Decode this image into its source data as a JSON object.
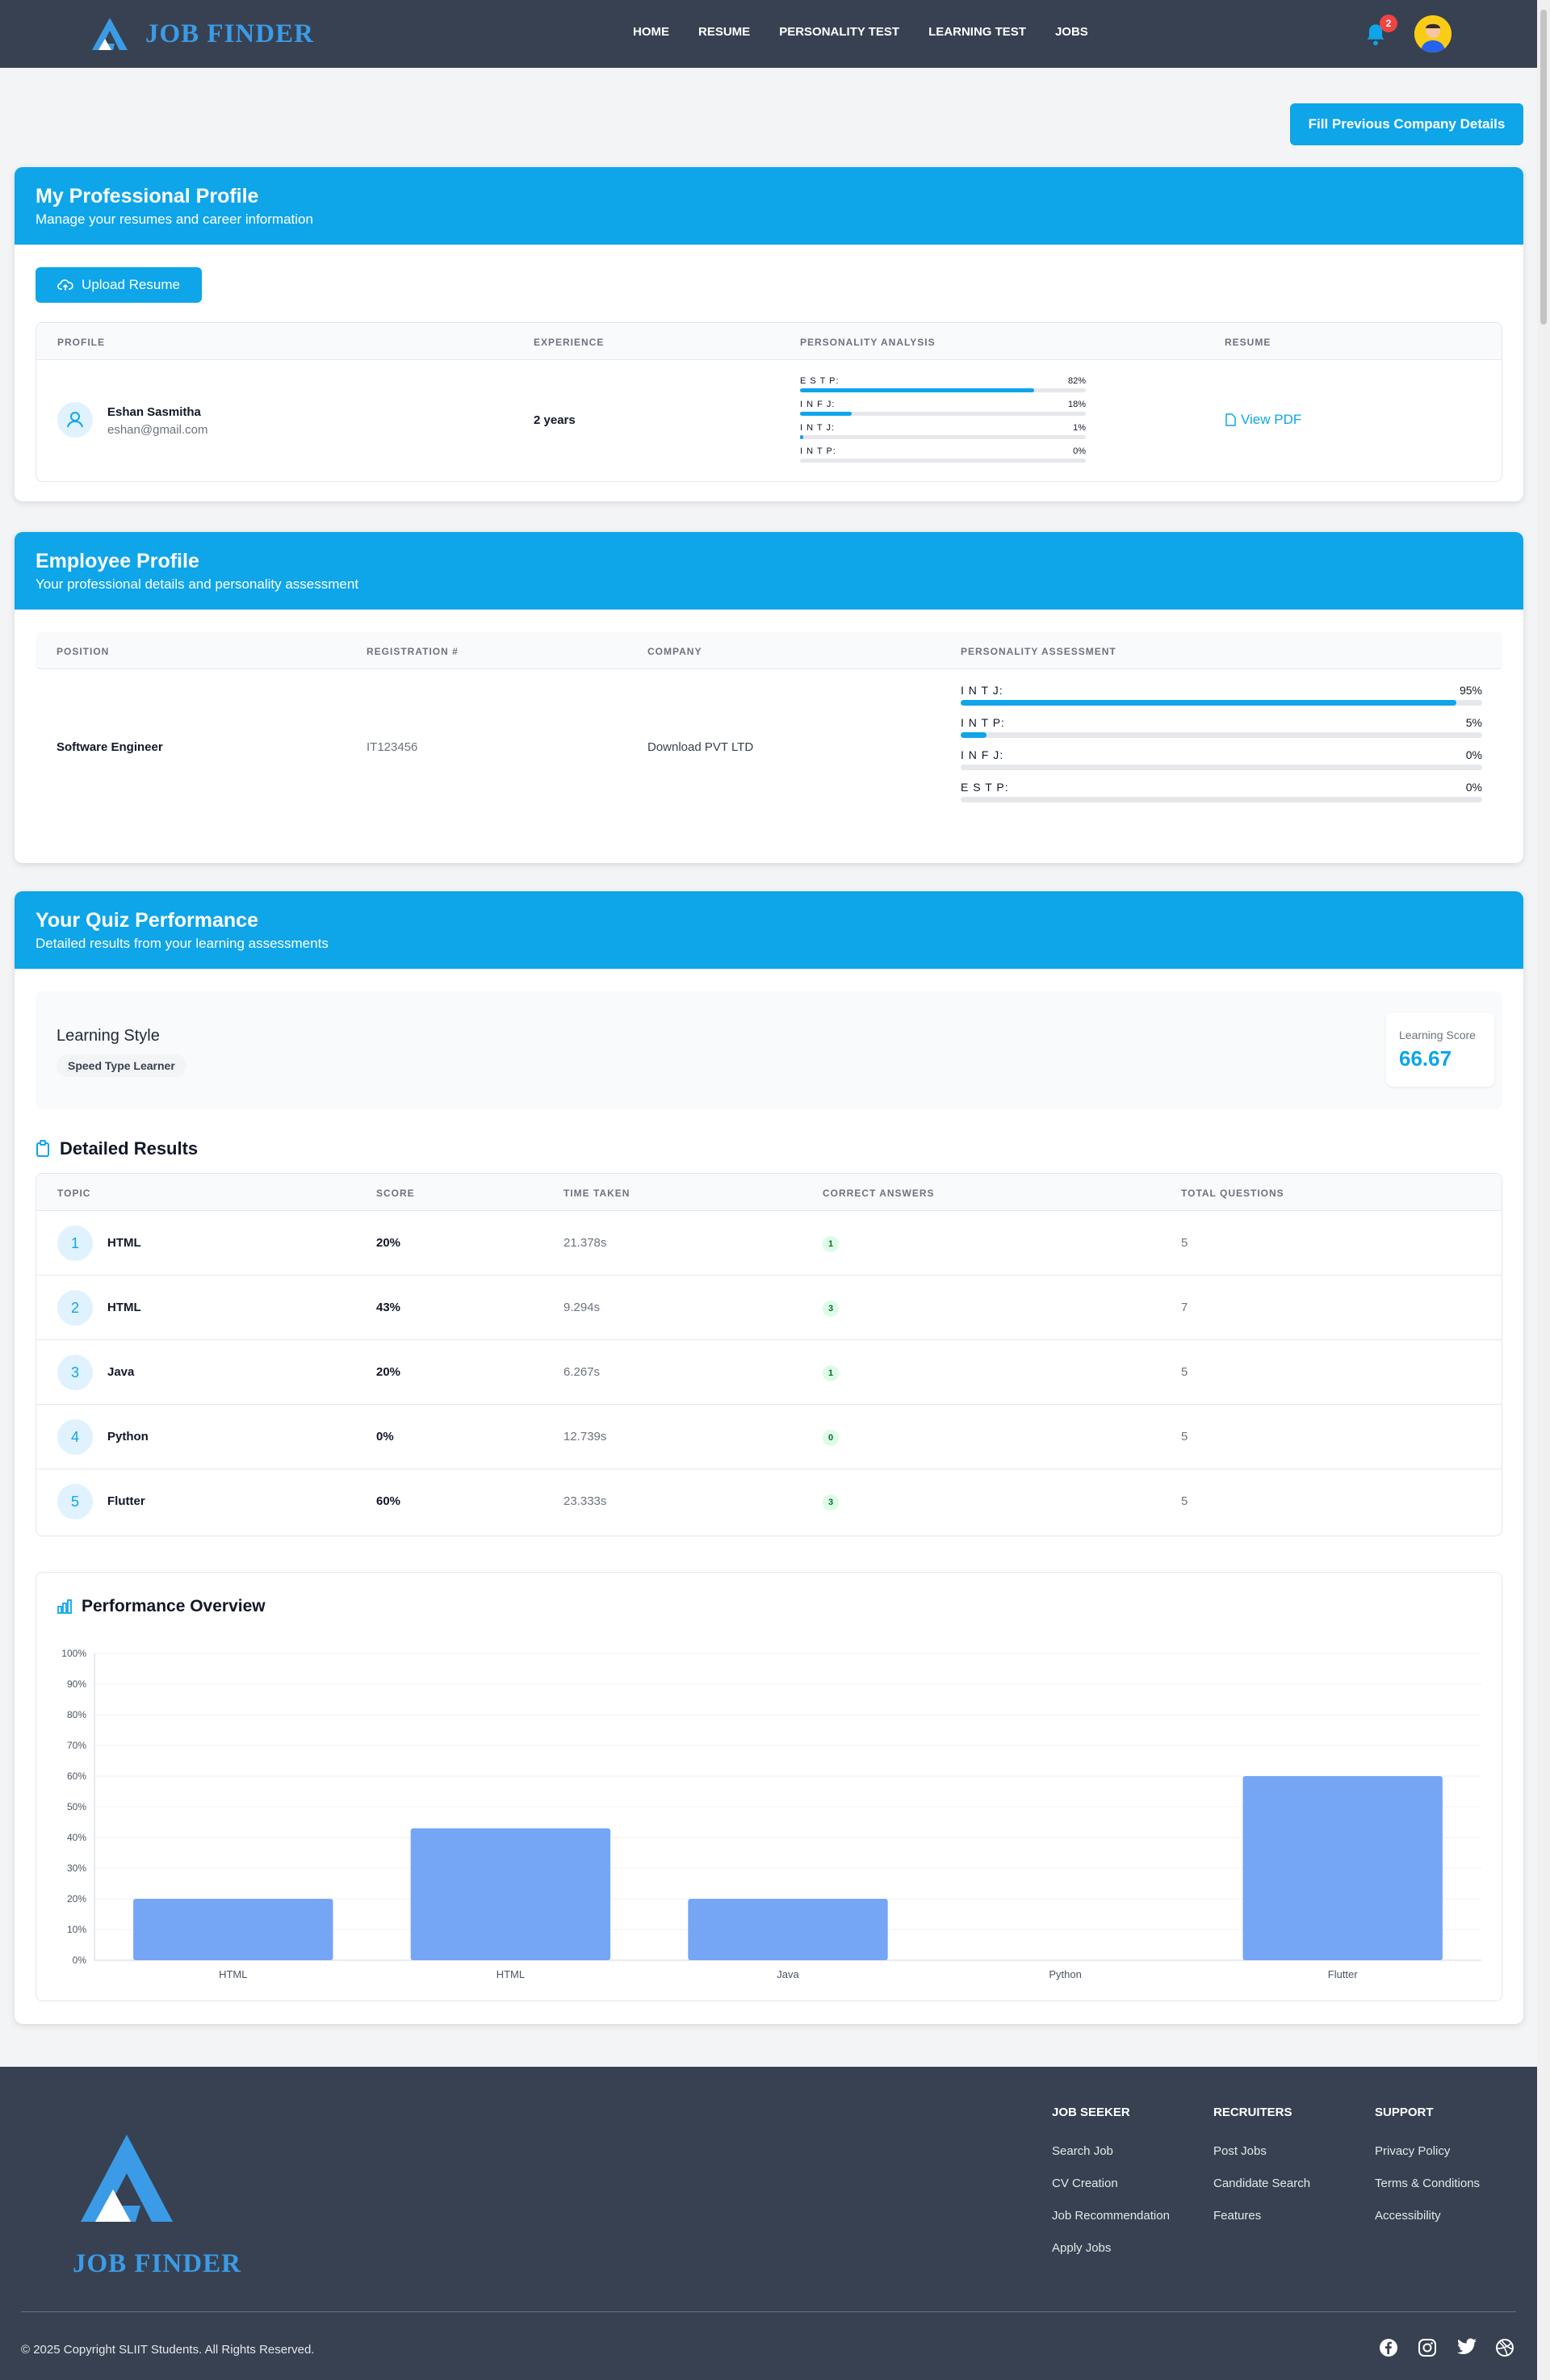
{
  "header": {
    "brand": "JOB FINDER",
    "nav": [
      "HOME",
      "RESUME",
      "PERSONALITY TEST",
      "LEARNING TEST",
      "JOBS"
    ],
    "notification_count": "2"
  },
  "actions": {
    "fill_previous": "Fill Previous Company Details"
  },
  "professional_profile": {
    "title": "My Professional Profile",
    "subtitle": "Manage your resumes and career information",
    "upload_label": "Upload Resume",
    "columns": [
      "PROFILE",
      "EXPERIENCE",
      "PERSONALITY ANALYSIS",
      "RESUME"
    ],
    "name": "Eshan Sasmitha",
    "email": "eshan@gmail.com",
    "experience": "2 years",
    "personality": [
      {
        "type": "E S T P:",
        "percent": "82%",
        "value": 82
      },
      {
        "type": "I N F J:",
        "percent": "18%",
        "value": 18
      },
      {
        "type": "I N T J:",
        "percent": "1%",
        "value": 1
      },
      {
        "type": "I N T P:",
        "percent": "0%",
        "value": 0
      }
    ],
    "resume_link": "View PDF"
  },
  "employee_profile": {
    "title": "Employee Profile",
    "subtitle": "Your professional details and personality assessment",
    "columns": [
      "POSITION",
      "REGISTRATION #",
      "COMPANY",
      "PERSONALITY ASSESSMENT"
    ],
    "position": "Software Engineer",
    "registration": "IT123456",
    "company": "Download PVT LTD",
    "personality": [
      {
        "type": "I N T J:",
        "percent": "95%",
        "value": 95
      },
      {
        "type": "I N T P:",
        "percent": "5%",
        "value": 5
      },
      {
        "type": "I N F J:",
        "percent": "0%",
        "value": 0
      },
      {
        "type": "E S T P:",
        "percent": "0%",
        "value": 0
      }
    ]
  },
  "quiz": {
    "title": "Your Quiz Performance",
    "subtitle": "Detailed results from your learning assessments",
    "learning_style_label": "Learning Style",
    "learning_style": "Speed Type Learner",
    "score_label": "Learning Score",
    "score": "66.67",
    "results_title": "Detailed Results",
    "columns": [
      "TOPIC",
      "SCORE",
      "TIME TAKEN",
      "CORRECT ANSWERS",
      "TOTAL QUESTIONS"
    ],
    "rows": [
      {
        "n": "1",
        "topic": "HTML",
        "score": "20%",
        "time": "21.378s",
        "correct": "1",
        "total": "5"
      },
      {
        "n": "2",
        "topic": "HTML",
        "score": "43%",
        "time": "9.294s",
        "correct": "3",
        "total": "7"
      },
      {
        "n": "3",
        "topic": "Java",
        "score": "20%",
        "time": "6.267s",
        "correct": "1",
        "total": "5"
      },
      {
        "n": "4",
        "topic": "Python",
        "score": "0%",
        "time": "12.739s",
        "correct": "0",
        "total": "5"
      },
      {
        "n": "5",
        "topic": "Flutter",
        "score": "60%",
        "time": "23.333s",
        "correct": "3",
        "total": "5"
      }
    ],
    "chart_title": "Performance Overview"
  },
  "chart_data": {
    "type": "bar",
    "categories": [
      "HTML",
      "HTML",
      "Java",
      "Python",
      "Flutter"
    ],
    "values": [
      20,
      43,
      20,
      0,
      60
    ],
    "ylim": [
      0,
      100
    ],
    "yticks": [
      "0%",
      "10%",
      "20%",
      "30%",
      "40%",
      "50%",
      "60%",
      "70%",
      "80%",
      "90%",
      "100%"
    ],
    "bar_color": "#75a5f5",
    "grid": true
  },
  "footer": {
    "brand": "JOB FINDER",
    "columns": [
      {
        "title": "JOB SEEKER",
        "links": [
          "Search Job",
          "CV Creation",
          "Job Recommendation",
          "Apply Jobs"
        ]
      },
      {
        "title": "RECRUITERS",
        "links": [
          "Post Jobs",
          "Candidate Search",
          "Features"
        ]
      },
      {
        "title": "SUPPORT",
        "links": [
          "Privacy Policy",
          "Terms & Conditions",
          "Accessibility"
        ]
      }
    ],
    "copyright": "© 2025 Copyright SLIIT Students. All Rights Reserved.",
    "socials": [
      "facebook-icon",
      "instagram-icon",
      "twitter-icon",
      "dribbble-icon"
    ]
  },
  "colors": {
    "primary": "#0ea5e9",
    "header": "#374151",
    "background": "#f3f4f6"
  }
}
